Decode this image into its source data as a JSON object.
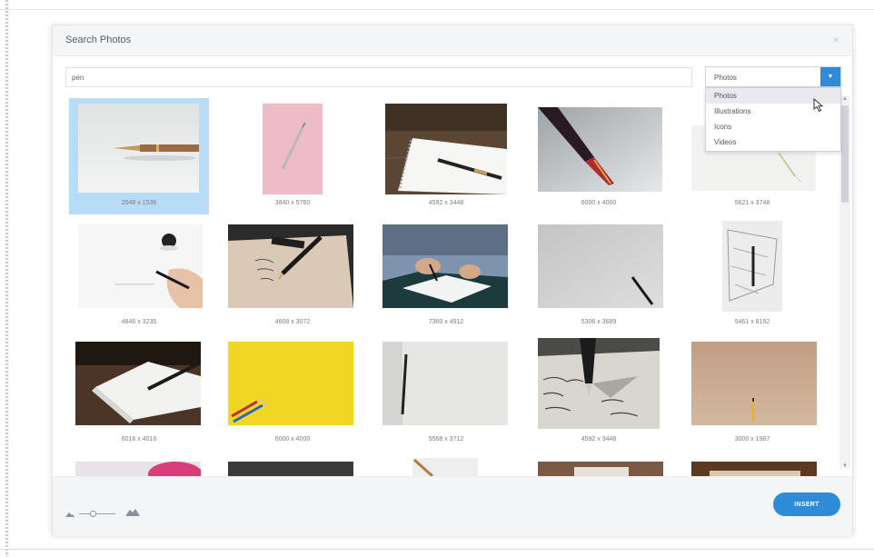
{
  "dialog": {
    "title": "Search Photos",
    "close_icon": "×"
  },
  "search": {
    "value": "pen",
    "placeholder": ""
  },
  "type_select": {
    "selected": "Photos",
    "options": [
      "Photos",
      "Illustrations",
      "Icons",
      "Videos"
    ]
  },
  "results": [
    {
      "size": "2048 x 1536",
      "description": "fountain pen on white",
      "selected": true
    },
    {
      "size": "3840 x 5760",
      "description": "pen on pink"
    },
    {
      "size": "4592 x 3448",
      "description": "notebook with pen on wood"
    },
    {
      "size": "6000 x 4000",
      "description": "red fountain pen writing"
    },
    {
      "size": "5621 x 3748",
      "description": "pencil on white"
    },
    {
      "size": "4846 x 3235",
      "description": "hand writing with pen"
    },
    {
      "size": "4608 x 3072",
      "description": "pen on handwritten paper"
    },
    {
      "size": "7360 x 4912",
      "description": "person writing at desk"
    },
    {
      "size": "5306 x 3689",
      "description": "pen on grey"
    },
    {
      "size": "5461 x 8192",
      "description": "pen sketch"
    },
    {
      "size": "6016 x 4016",
      "description": "notebook with pen"
    },
    {
      "size": "6000 x 4000",
      "description": "pencils on yellow"
    },
    {
      "size": "5568 x 3712",
      "description": "pencil on white paper"
    },
    {
      "size": "4592 x 3448",
      "description": "fountain pen writing on notebook"
    },
    {
      "size": "3000 x 1987",
      "description": "pencil on beige"
    }
  ],
  "footer": {
    "insert_label": "INSERT",
    "zoom_small_icon": "mountain-small-icon",
    "zoom_large_icon": "mountain-large-icon"
  },
  "colors": {
    "accent": "#2f8bd8",
    "selection": "#b8dcf6"
  }
}
